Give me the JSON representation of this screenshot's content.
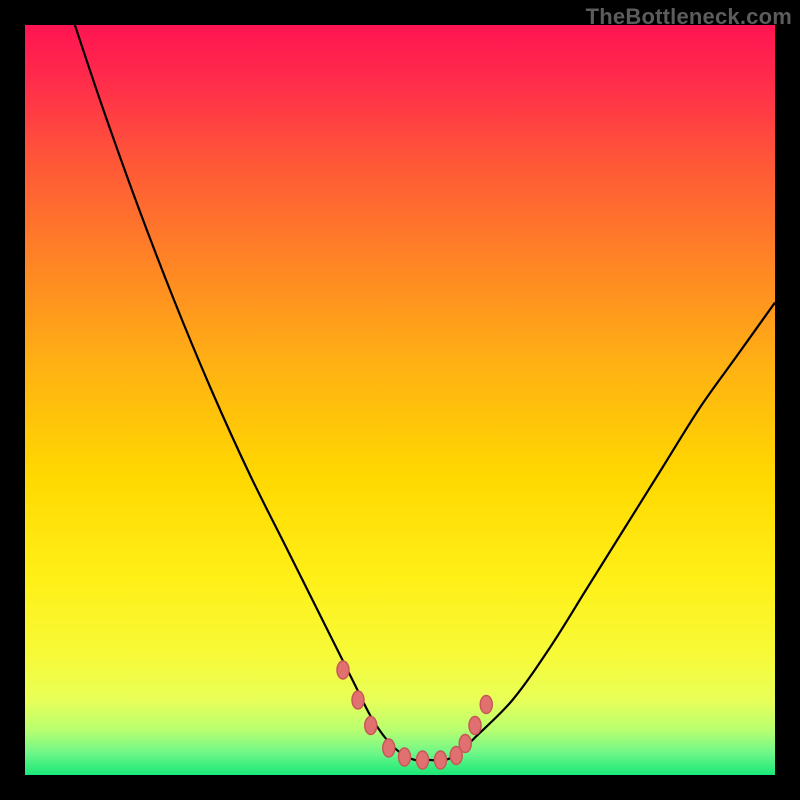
{
  "watermark": {
    "text": "TheBottleneck.com"
  },
  "gradient": {
    "stops": [
      {
        "offset": 0.0,
        "color": "#ff1452"
      },
      {
        "offset": 0.08,
        "color": "#ff2e4a"
      },
      {
        "offset": 0.18,
        "color": "#ff5638"
      },
      {
        "offset": 0.3,
        "color": "#ff7f27"
      },
      {
        "offset": 0.45,
        "color": "#ffb014"
      },
      {
        "offset": 0.6,
        "color": "#ffd800"
      },
      {
        "offset": 0.74,
        "color": "#fff018"
      },
      {
        "offset": 0.84,
        "color": "#f7fa38"
      },
      {
        "offset": 0.9,
        "color": "#e8ff58"
      },
      {
        "offset": 0.94,
        "color": "#b8ff70"
      },
      {
        "offset": 0.97,
        "color": "#70f788"
      },
      {
        "offset": 1.0,
        "color": "#18e878"
      }
    ]
  },
  "curve_style": {
    "stroke": "#000000",
    "stroke_width": 2.2
  },
  "marker_style": {
    "fill": "#e17070",
    "stroke": "#c85858",
    "stroke_width": 1.5,
    "rx": 6,
    "ry": 9
  },
  "chart_data": {
    "type": "line",
    "title": "",
    "xlabel": "",
    "ylabel": "",
    "xlim": [
      0,
      100
    ],
    "ylim": [
      0,
      100
    ],
    "x": [
      5,
      10,
      15,
      20,
      25,
      30,
      35,
      40,
      42,
      44,
      46,
      48,
      50,
      52,
      54,
      56,
      58,
      60,
      65,
      70,
      75,
      80,
      85,
      90,
      95,
      100
    ],
    "values": [
      105,
      90,
      76,
      63,
      51,
      40,
      30,
      20,
      16,
      12,
      8,
      5,
      3,
      2,
      2,
      2,
      3,
      5,
      10,
      17,
      25,
      33,
      41,
      49,
      56,
      63
    ],
    "markers": {
      "x": [
        42.4,
        44.4,
        46.1,
        48.5,
        50.6,
        53.0,
        55.4,
        57.5,
        58.7,
        60.0,
        61.5
      ],
      "y": [
        14.0,
        10.0,
        6.6,
        3.6,
        2.4,
        2.0,
        2.0,
        2.6,
        4.2,
        6.6,
        9.4
      ]
    }
  }
}
